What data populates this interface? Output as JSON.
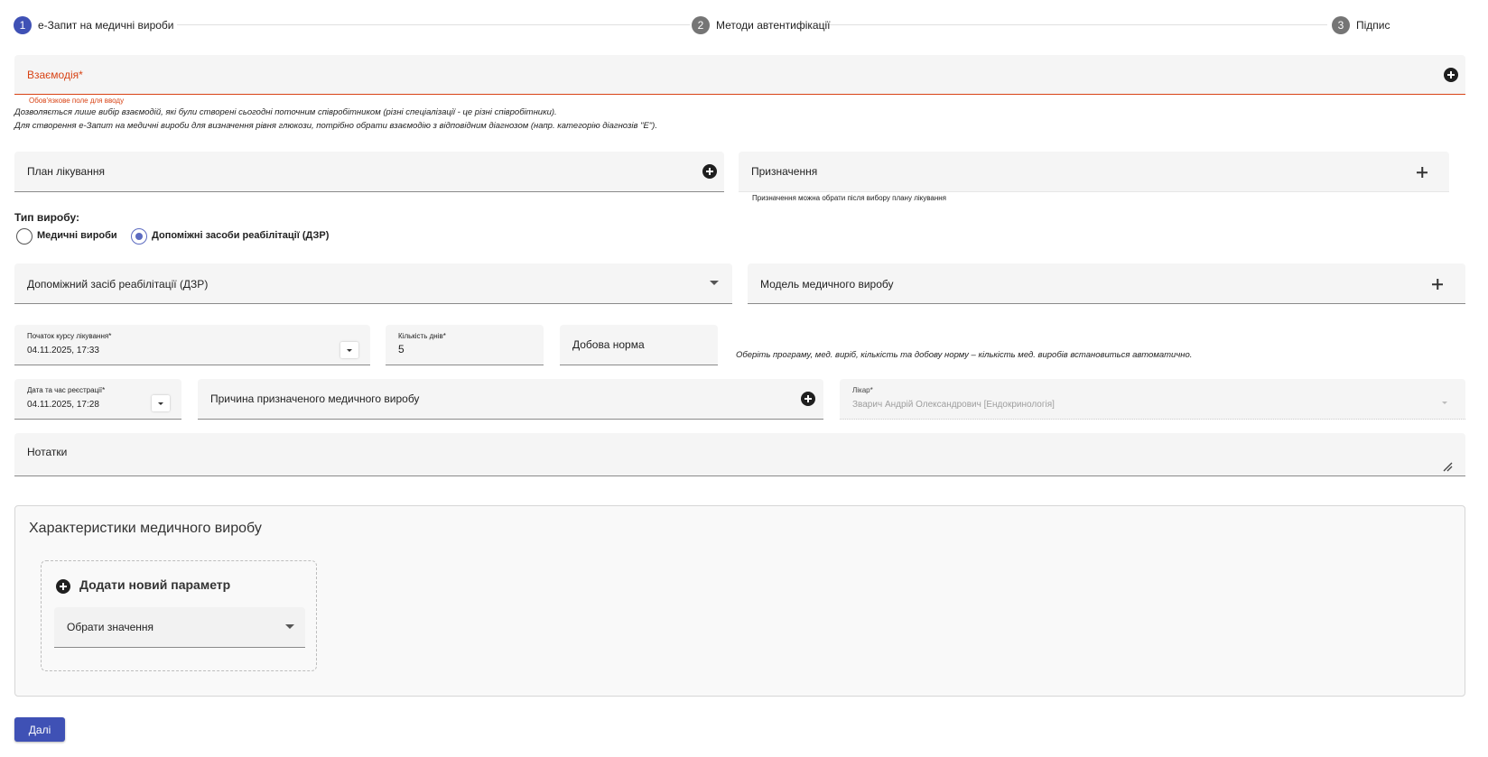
{
  "stepper": {
    "steps": [
      {
        "num": "1",
        "label": "е-Запит на медичні вироби"
      },
      {
        "num": "2",
        "label": "Методи автентифікації"
      },
      {
        "num": "3",
        "label": "Підпис"
      }
    ]
  },
  "interaction": {
    "label": "Взаємодія*",
    "error": "Обов'язкове поле для вводу",
    "note1": "Дозволяється лише вибір взаємодій, які були створені сьогодні поточним співробітником (різні спеціалізації - це різні співробітники).",
    "note2": "Для створення е-Запит на медичні вироби для визначення рівня глюкози, потрібно обрати взаємодію з відповідним діагнозом (напр. категорію діагнозів \"E\")."
  },
  "treatment_plan": {
    "label": "План лікування"
  },
  "prescription": {
    "label": "Призначення",
    "helper": "Призначення можна обрати після вибору плану лікування"
  },
  "product_type": {
    "label": "Тип виробу:",
    "options": [
      "Медичні вироби",
      "Допоміжні засоби реабілітації (ДЗР)"
    ],
    "selected": "Допоміжні засоби реабілітації (ДЗР)"
  },
  "rehab_device": {
    "label": "Допоміжний засіб реабілітації (ДЗР)"
  },
  "device_model": {
    "label": "Модель медичного виробу"
  },
  "course_start": {
    "label": "Початок курсу лікування*",
    "value": "04.11.2025, 17:33"
  },
  "days_count": {
    "label": "Кількість днів*",
    "value": "5"
  },
  "daily_norm": {
    "label": "Добова норма"
  },
  "auto_note": "Оберіть програму, мед. виріб, кількість та добову норму – кількість мед. виробів встановиться автоматично.",
  "registration": {
    "label": "Дата та час реєстрації*",
    "value": "04.11.2025, 17:28"
  },
  "reason": {
    "label": "Причина призначеного медичного виробу"
  },
  "doctor": {
    "label": "Лікар*",
    "value": "Зварич Андрій Олександрович [Ендокринологія]"
  },
  "notes": {
    "label": "Нотатки"
  },
  "characteristics": {
    "title": "Характеристики медичного виробу",
    "add_param": "Додати новий параметр",
    "select_placeholder": "Обрати значення"
  },
  "next_button": "Далі",
  "colors": {
    "primary": "#3f51b5",
    "error": "#d84315",
    "field_bg": "#f5f5f5"
  }
}
